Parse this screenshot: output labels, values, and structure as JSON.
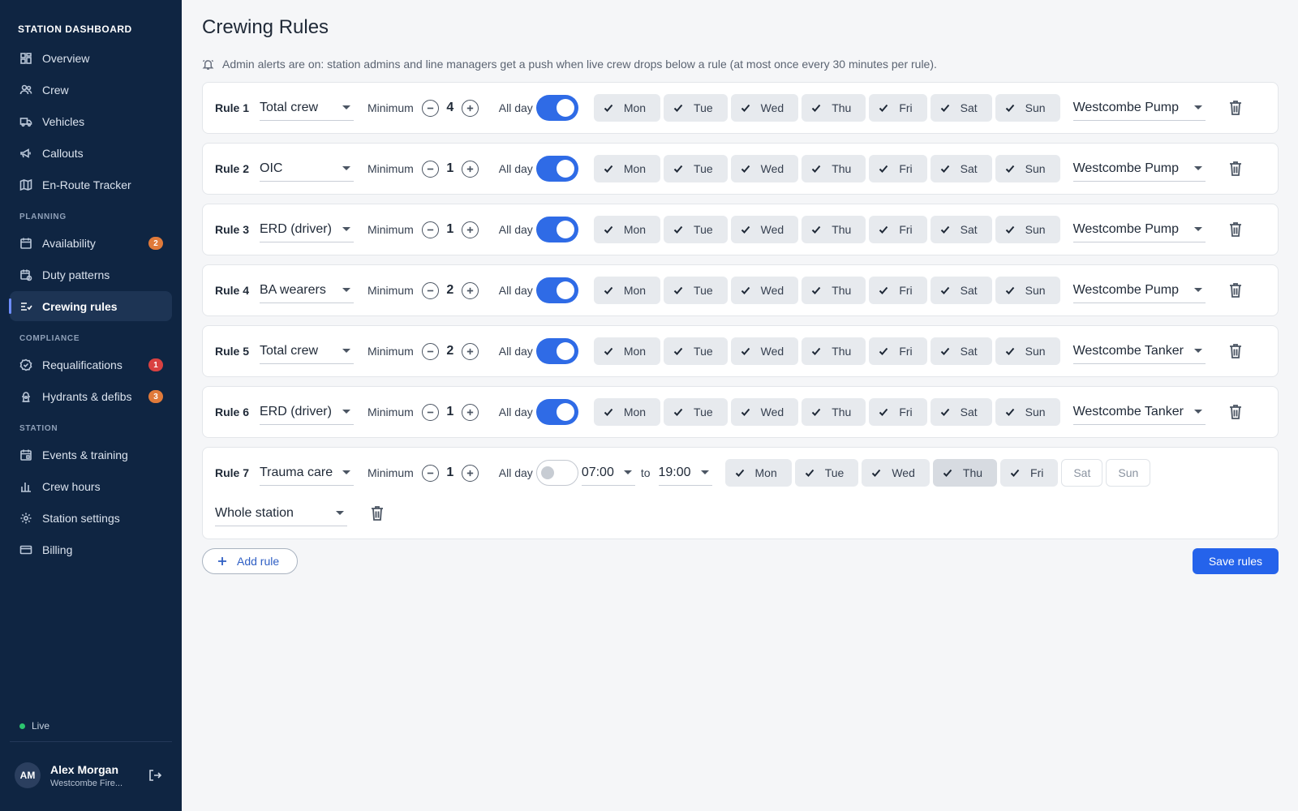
{
  "sidebar": {
    "brand": "STATION DASHBOARD",
    "main_items": [
      {
        "label": "Overview",
        "icon": "dashboard-icon"
      },
      {
        "label": "Crew",
        "icon": "users-icon"
      },
      {
        "label": "Vehicles",
        "icon": "truck-icon"
      },
      {
        "label": "Callouts",
        "icon": "megaphone-icon"
      },
      {
        "label": "En-Route Tracker",
        "icon": "map-icon"
      }
    ],
    "planning_header": "PLANNING",
    "planning_items": [
      {
        "label": "Availability",
        "icon": "calendar-icon",
        "badge": "2"
      },
      {
        "label": "Duty patterns",
        "icon": "calendar-clock-icon"
      },
      {
        "label": "Crewing rules",
        "icon": "rules-icon",
        "active": true
      }
    ],
    "compliance_header": "COMPLIANCE",
    "compliance_items": [
      {
        "label": "Requalifications",
        "icon": "badge-check-icon",
        "badge": "1"
      },
      {
        "label": "Hydrants & defibs",
        "icon": "hydrant-icon",
        "badge": "3"
      }
    ],
    "station_header": "STATION",
    "station_items": [
      {
        "label": "Events & training",
        "icon": "event-icon"
      },
      {
        "label": "Crew hours",
        "icon": "bar-chart-icon"
      },
      {
        "label": "Station settings",
        "icon": "gear-icon"
      },
      {
        "label": "Billing",
        "icon": "credit-card-icon"
      }
    ],
    "status": "Live",
    "status_color": "#2cc56f",
    "user": {
      "initials": "AM",
      "name": "Alex Morgan",
      "org": "Westcombe Fire..."
    }
  },
  "page": {
    "title": "Crewing Rules",
    "alert": "Admin alerts are on: station admins and line managers get a push when live crew drops below a rule (at most once every 30 minutes per rule).",
    "minimum_label": "Minimum",
    "allday_label": "All day",
    "to_label": "to",
    "add_rule": "Add rule",
    "save_rules": "Save rules",
    "accent": "#2563eb"
  },
  "rules": [
    {
      "label": "Rule 1",
      "role": "Total crew",
      "minimum": "4",
      "all_day": true,
      "station": "Westcombe Pump"
    },
    {
      "label": "Rule 2",
      "role": "OIC",
      "minimum": "1",
      "all_day": true,
      "station": "Westcombe Pump"
    },
    {
      "label": "Rule 3",
      "role": "ERD (driver)",
      "minimum": "1",
      "all_day": true,
      "station": "Westcombe Pump"
    },
    {
      "label": "Rule 4",
      "role": "BA wearers",
      "minimum": "2",
      "all_day": true,
      "station": "Westcombe Pump"
    },
    {
      "label": "Rule 5",
      "role": "Total crew",
      "minimum": "2",
      "all_day": true,
      "station": "Westcombe Tanker"
    },
    {
      "label": "Rule 6",
      "role": "ERD (driver)",
      "minimum": "1",
      "all_day": true,
      "station": "Westcombe Tanker"
    },
    {
      "label": "Rule 7",
      "role": "Trauma care",
      "minimum": "1",
      "all_day": false,
      "start": "07:00",
      "end": "19:00",
      "station": "Whole station"
    }
  ],
  "days": {
    "mon": "Mon",
    "tue": "Tue",
    "wed": "Wed",
    "thu": "Thu",
    "fri": "Fri",
    "sat": "Sat",
    "sun": "Sun"
  }
}
